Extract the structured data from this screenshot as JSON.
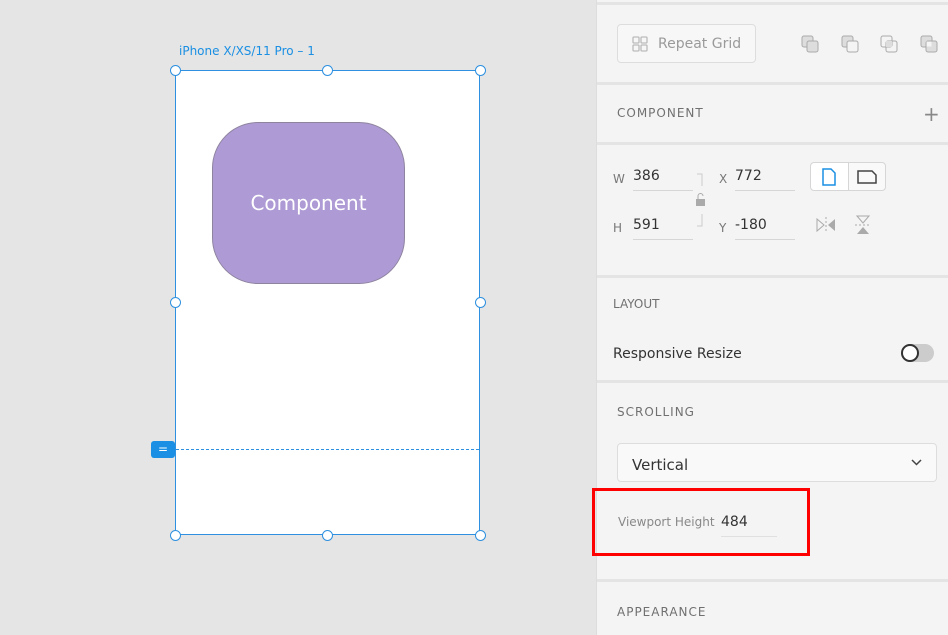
{
  "canvas": {
    "artboard_title": "iPhone X/XS/11 Pro – 1",
    "component_label": "Component",
    "viewport_marker": "="
  },
  "panel": {
    "repeat_grid": "Repeat Grid",
    "component": {
      "title": "COMPONENT",
      "add": "+"
    },
    "transform": {
      "w_label": "W",
      "w": "386",
      "h_label": "H",
      "h": "591",
      "x_label": "X",
      "x": "772",
      "y_label": "Y",
      "y": "-180"
    },
    "layout": {
      "title": "LAYOUT",
      "responsive_resize": "Responsive Resize",
      "responsive_resize_on": false
    },
    "scrolling": {
      "title": "SCROLLING",
      "selected": "Vertical",
      "viewport_height_label": "Viewport Height",
      "viewport_height": "484"
    },
    "appearance": {
      "title": "APPEARANCE"
    }
  },
  "colors": {
    "accent": "#1a8fe3",
    "component_fill": "#ae9ad4",
    "highlight": "#ff0000"
  }
}
